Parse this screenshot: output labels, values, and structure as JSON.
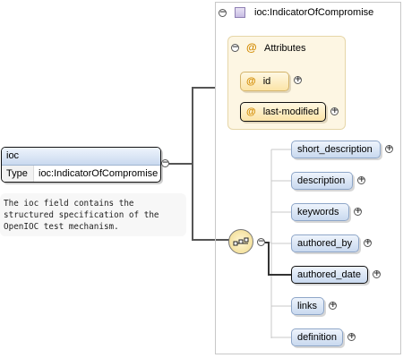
{
  "root": {
    "name": "ioc",
    "type_label": "Type",
    "type_value": "ioc:IndicatorOfCompromise",
    "annotation": "The ioc field contains the structured specification of the OpenIOC test mechanism."
  },
  "complex_type": {
    "name": "ioc:IndicatorOfCompromise",
    "attributes_title": "Attributes",
    "attributes": [
      "id",
      "last-modified"
    ]
  },
  "sequence": {
    "elements": [
      "short_description",
      "description",
      "keywords",
      "authored_by",
      "authored_date",
      "links",
      "definition"
    ]
  },
  "icons": {
    "attribute": "at-icon",
    "complex_type": "complex-type-icon",
    "sequence": "sequence-compositor-icon",
    "toggle_collapse": "collapse-icon",
    "toggle_expand": "expand-icon"
  },
  "colors": {
    "element_fill": "#c9d9ef",
    "attribute_fill": "#fbe4a6",
    "panel_bg": "#fdf6e3"
  }
}
